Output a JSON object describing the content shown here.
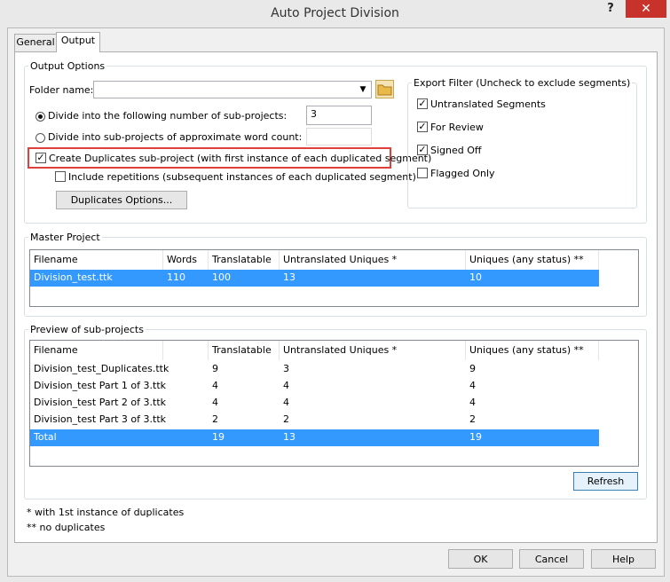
{
  "window": {
    "title": "Auto Project Division",
    "help_glyph": "?",
    "close_glyph": "✕"
  },
  "tabs": [
    {
      "label": "General"
    },
    {
      "label": "Output"
    }
  ],
  "output_options": {
    "group_label": "Output Options",
    "folder_label": "Folder name:",
    "folder_value": "",
    "radio_num_label": "Divide into the following number of sub-projects:",
    "radio_num_value": "3",
    "radio_words_label": "Divide into sub-projects of approximate word count:",
    "radio_words_value": "",
    "dup_label": "Create Duplicates sub-project (with first instance of each duplicated segment)",
    "rep_label": "Include repetitions (subsequent instances of each duplicated segment)",
    "dup_options_button": "Duplicates Options..."
  },
  "export_filter": {
    "group_label": "Export Filter (Uncheck to exclude segments)",
    "items": [
      {
        "label": "Untranslated Segments",
        "checked": true
      },
      {
        "label": "For Review",
        "checked": true
      },
      {
        "label": "Signed Off",
        "checked": true
      },
      {
        "label": "Flagged Only",
        "checked": false
      }
    ]
  },
  "master_project": {
    "group_label": "Master Project",
    "columns": [
      "Filename",
      "Words",
      "Translatable",
      "Untranslated Uniques *",
      "Uniques (any status) **"
    ],
    "rows": [
      [
        "Division_test.ttk",
        "110",
        "100",
        "13",
        "10"
      ]
    ]
  },
  "preview": {
    "group_label": "Preview of sub-projects",
    "columns": [
      "Filename",
      "",
      "Translatable",
      "Untranslated Uniques *",
      "Uniques (any status) **"
    ],
    "rows": [
      [
        "Division_test_Duplicates.ttk",
        "",
        "9",
        "3",
        "9"
      ],
      [
        "Division_test Part 1 of 3.ttk",
        "",
        "4",
        "4",
        "4"
      ],
      [
        "Division_test Part 2 of 3.ttk",
        "",
        "4",
        "4",
        "4"
      ],
      [
        "Division_test Part 3 of 3.ttk",
        "",
        "2",
        "2",
        "2"
      ],
      [
        "Total",
        "",
        "19",
        "13",
        "19"
      ]
    ],
    "refresh_button": "Refresh"
  },
  "notes": [
    "* with 1st instance of duplicates",
    "** no duplicates"
  ],
  "footer": {
    "ok": "OK",
    "cancel": "Cancel",
    "help": "Help"
  }
}
